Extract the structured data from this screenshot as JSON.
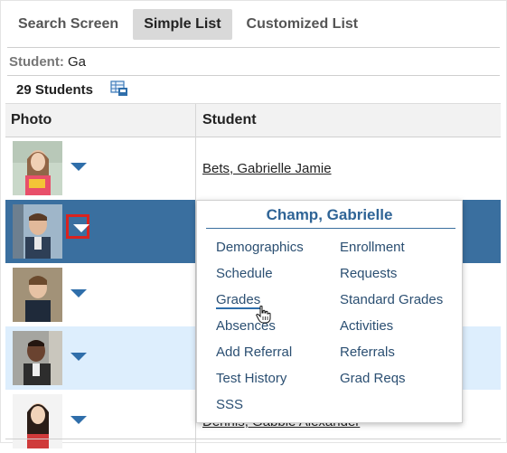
{
  "tabs": [
    {
      "label": "Search Screen",
      "active": false
    },
    {
      "label": "Simple List",
      "active": true
    },
    {
      "label": "Customized List",
      "active": false
    }
  ],
  "filter": {
    "label": "Student:",
    "value": "Ga"
  },
  "count_label": "29 Students",
  "table": {
    "headers": [
      "Photo",
      "Student"
    ],
    "rows": [
      {
        "name": "Bets, Gabrielle Jamie",
        "style": "normal"
      },
      {
        "name": "",
        "style": "selected"
      },
      {
        "name": "",
        "style": "normal"
      },
      {
        "name": "",
        "style": "alt"
      },
      {
        "name": "Dennis, Gabbie Alexander",
        "style": "normal"
      }
    ]
  },
  "popup": {
    "title": "Champ, Gabrielle",
    "left_items": [
      "Demographics",
      "Schedule",
      "Grades",
      "Absences",
      "Add Referral",
      "Test History",
      "SSS"
    ],
    "right_items": [
      "Enrollment",
      "Requests",
      "Standard Grades",
      "Activities",
      "Referrals",
      "Grad Reqs"
    ],
    "hovered": "Grades"
  },
  "colors": {
    "selected_row": "#3a6f9f",
    "alt_row": "#ddeefd",
    "link": "#2b4f72",
    "highlight_box": "#d9231f"
  },
  "icons": [
    "export-icon",
    "dropdown-arrow-icon",
    "hand-pointer-icon"
  ]
}
